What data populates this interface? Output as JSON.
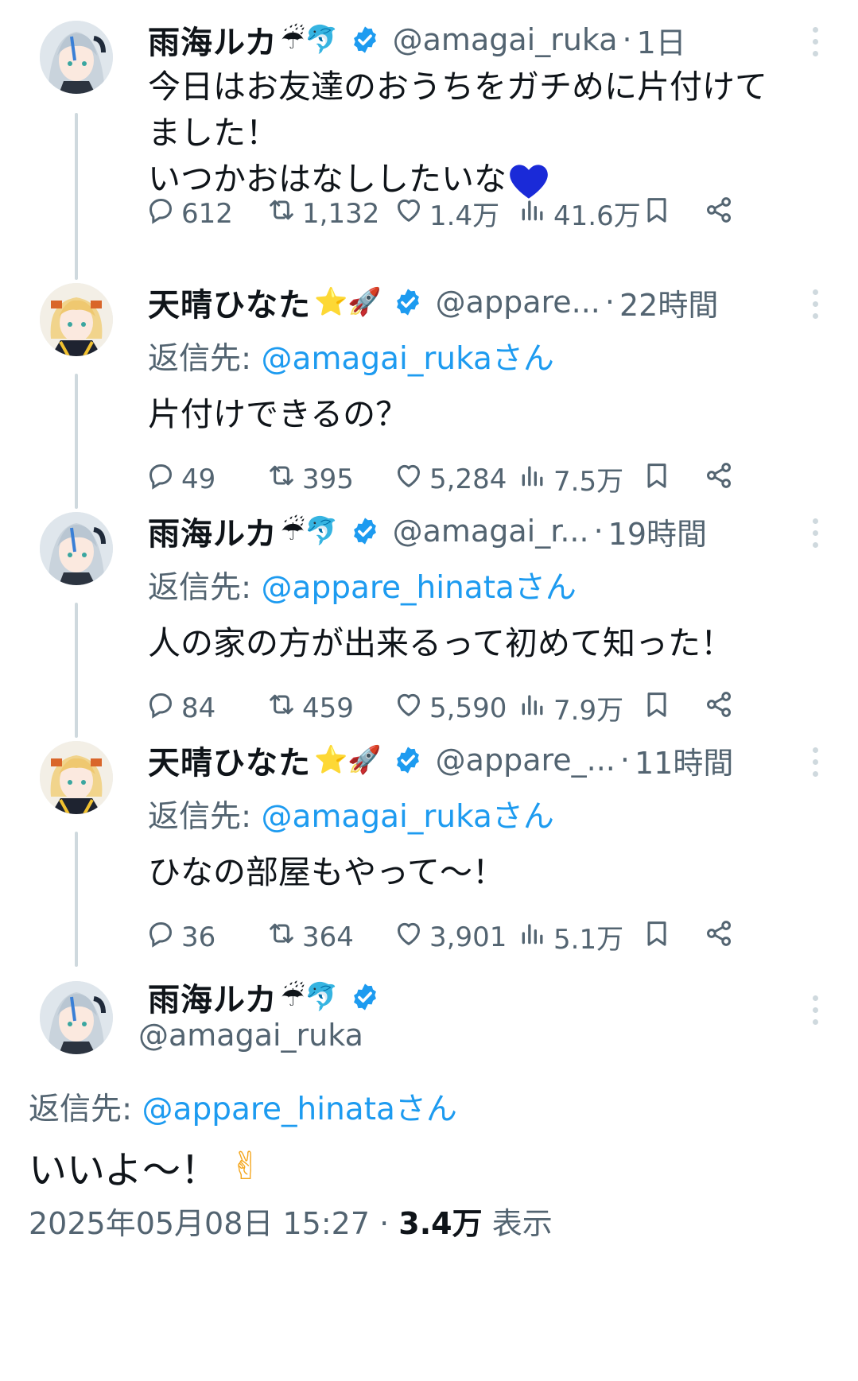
{
  "colors": {
    "accent": "#1d9bf0",
    "secondary_text": "#536471",
    "thread_line": "#cfd9de"
  },
  "tweets": [
    {
      "name": "雨海ルカ",
      "name_emoji": "☔🐬",
      "handle": "@amagai_ruka",
      "time": "1日",
      "reply_prefix": "",
      "reply_mention": "",
      "text": "今日はお友達のおうちをガチめに片付けて\nました！\nいつかおはなししたいな",
      "text_emoji": "blue-heart",
      "stats": {
        "replies": "612",
        "reposts": "1,132",
        "likes": "1.4万",
        "views": "41.6万"
      }
    },
    {
      "name": "天晴ひなた",
      "name_emoji": "⭐🚀",
      "handle": "@appare...",
      "time": "22時間",
      "reply_prefix": "返信先: ",
      "reply_mention": "@amagai_rukaさん",
      "text": "片付けできるの？",
      "stats": {
        "replies": "49",
        "reposts": "395",
        "likes": "5,284",
        "views": "7.5万"
      }
    },
    {
      "name": "雨海ルカ",
      "name_emoji": "☔🐬",
      "handle": "@amagai_r...",
      "time": "19時間",
      "reply_prefix": "返信先: ",
      "reply_mention": "@appare_hinataさん",
      "text": "人の家の方が出来るって初めて知った！",
      "stats": {
        "replies": "84",
        "reposts": "459",
        "likes": "5,590",
        "views": "7.9万"
      }
    },
    {
      "name": "天晴ひなた",
      "name_emoji": "⭐🚀",
      "handle": "@appare_...",
      "time": "11時間",
      "reply_prefix": "返信先: ",
      "reply_mention": "@amagai_rukaさん",
      "text": "ひなの部屋もやって〜！",
      "stats": {
        "replies": "36",
        "reposts": "364",
        "likes": "3,901",
        "views": "5.1万"
      }
    }
  ],
  "main_tweet": {
    "name": "雨海ルカ",
    "name_emoji": "☔🐬",
    "handle": "@amagai_ruka",
    "reply_prefix": "返信先: ",
    "reply_mention": "@appare_hinataさん",
    "text": "いいよ〜！",
    "text_emoji": "✌",
    "timestamp": "2025年05月08日 15:27",
    "separator": "·",
    "views_count": "3.4万",
    "views_label": "表示"
  },
  "icons": [
    "reply-icon",
    "repost-icon",
    "like-icon",
    "views-icon",
    "bookmark-icon",
    "share-icon",
    "more-icon",
    "verified-icon"
  ]
}
